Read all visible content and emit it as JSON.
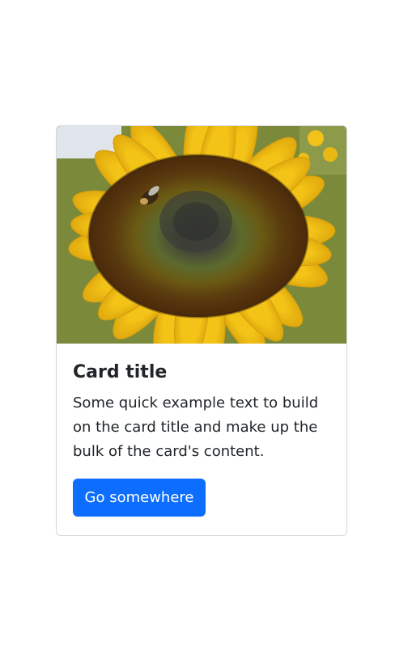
{
  "card": {
    "image_alt": "sunflower with a bee",
    "title": "Card title",
    "text": "Some quick example text to build on the card title and make up the bulk of the card's content.",
    "button_label": "Go somewhere"
  },
  "colors": {
    "button_bg": "#0d6efd",
    "button_text": "#ffffff",
    "petal_yellow": "#f7c81a",
    "card_border": "#d5d8dc"
  }
}
